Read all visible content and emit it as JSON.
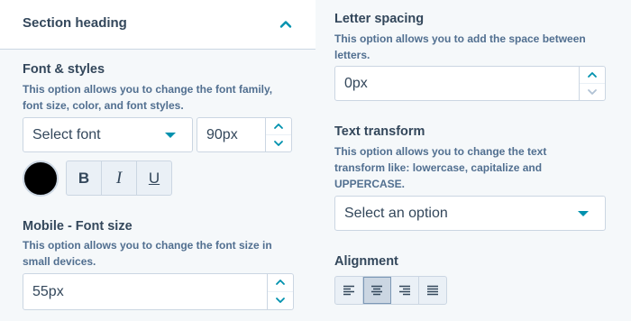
{
  "section": {
    "heading": "Section heading"
  },
  "font_styles": {
    "label": "Font & styles",
    "help": "This option allows you to change the font family, font size, color, and font styles.",
    "font_select_value": "Select font",
    "font_size_value": "90px",
    "color": "#000000",
    "bold_label": "B",
    "italic_label": "I",
    "underline_label": "U"
  },
  "mobile_font_size": {
    "label": "Mobile - Font size",
    "help": "This option allows you to change the font size in small devices.",
    "value": "55px"
  },
  "letter_spacing": {
    "label": "Letter spacing",
    "help": "This option allows you to add the space between letters.",
    "value": "0px"
  },
  "text_transform": {
    "label": "Text transform",
    "help": "This option allows you to change the text transform like: lowercase, capitalize and UPPERCASE.",
    "select_value": "Select an option"
  },
  "alignment": {
    "label": "Alignment",
    "options": [
      "left",
      "center",
      "right",
      "justify"
    ],
    "selected": "center"
  },
  "colors": {
    "accent": "#0091ae",
    "text": "#33475b",
    "help_text": "#516f90",
    "border": "#cbd6e2"
  }
}
